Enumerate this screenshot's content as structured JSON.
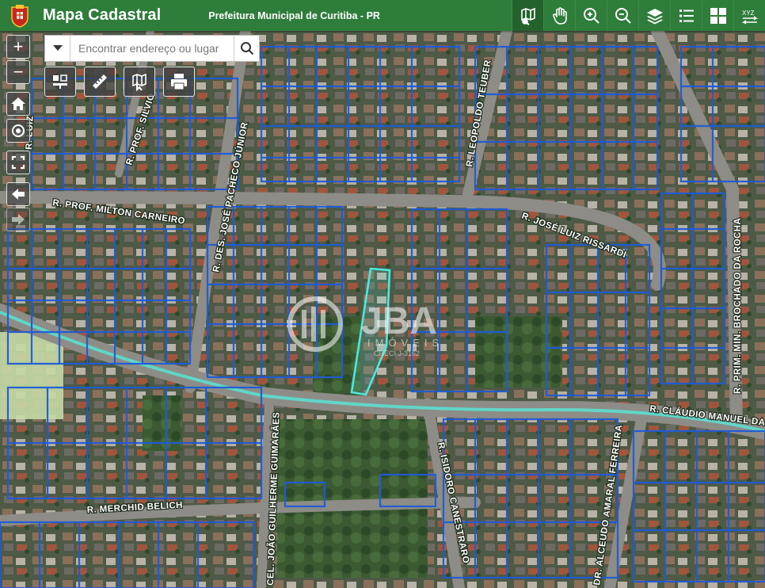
{
  "header": {
    "title": "Mapa Cadastral",
    "subtitle": "Prefeitura Municipal de Curitiba - PR",
    "logo_icon": "curitiba-crest-icon",
    "tools": [
      {
        "name": "identify-tool",
        "icon": "map-pointer-icon",
        "active": true
      },
      {
        "name": "pan-tool",
        "icon": "hand-icon",
        "active": false
      },
      {
        "name": "zoom-in-tool",
        "icon": "zoom-in-icon",
        "active": false
      },
      {
        "name": "zoom-out-tool",
        "icon": "zoom-out-icon",
        "active": false
      },
      {
        "name": "layers-tool",
        "icon": "layers-icon",
        "active": false
      },
      {
        "name": "legend-tool",
        "icon": "list-icon",
        "active": false
      },
      {
        "name": "basemap-tool",
        "icon": "grid-icon",
        "active": false
      },
      {
        "name": "xyz-tool",
        "icon": "xyz-coordinates-icon",
        "label": "XYZ",
        "active": false
      }
    ]
  },
  "search": {
    "placeholder": "Encontrar endereço ou lugar"
  },
  "map_tools": [
    {
      "name": "measure-area-tool",
      "icon": "area-tool-icon"
    },
    {
      "name": "ruler-tool",
      "icon": "ruler-icon"
    },
    {
      "name": "map-select-tool",
      "icon": "map-pointer-icon"
    },
    {
      "name": "print-tool",
      "icon": "printer-icon"
    }
  ],
  "nav_controls": {
    "zoom_in": "+",
    "zoom_out": "−",
    "home_icon": "home-icon",
    "locate_icon": "locate-icon",
    "fullscreen_icon": "fullscreen-icon",
    "back_icon": "arrow-left-icon",
    "forward_icon": "arrow-right-icon"
  },
  "streets": [
    "R. PROF. MILTON CARNEIRO",
    "R. DES. JOSÉ PACHECO JÚNIOR",
    "R. LEOPOLDO TEUBER",
    "R. JOSÉ LUIZ RISSARDI",
    "R. PRIM. MIN. BROCHADO DA ROCHA",
    "R. CLÁUDIO MANUEL DA",
    "R. ISIDORO CANESTRARO",
    "DR. ALCEUDO AMARAL FERREIRA",
    "CEL. JOÃO GUILHERME GUIMARÃES",
    "R. MERCHID BELICH",
    "R. PROF. SILVIO",
    "R. LUIZ"
  ],
  "watermark": {
    "brand": "JBA",
    "sub": "IMÓVEIS",
    "creci": "CRECI J-3162"
  },
  "colors": {
    "header_green": "#2f7d3a",
    "parcel_blue": "#1e5bd8",
    "highlight_cyan": "#4fe8e0",
    "selected_road": "#5fd6c8"
  }
}
